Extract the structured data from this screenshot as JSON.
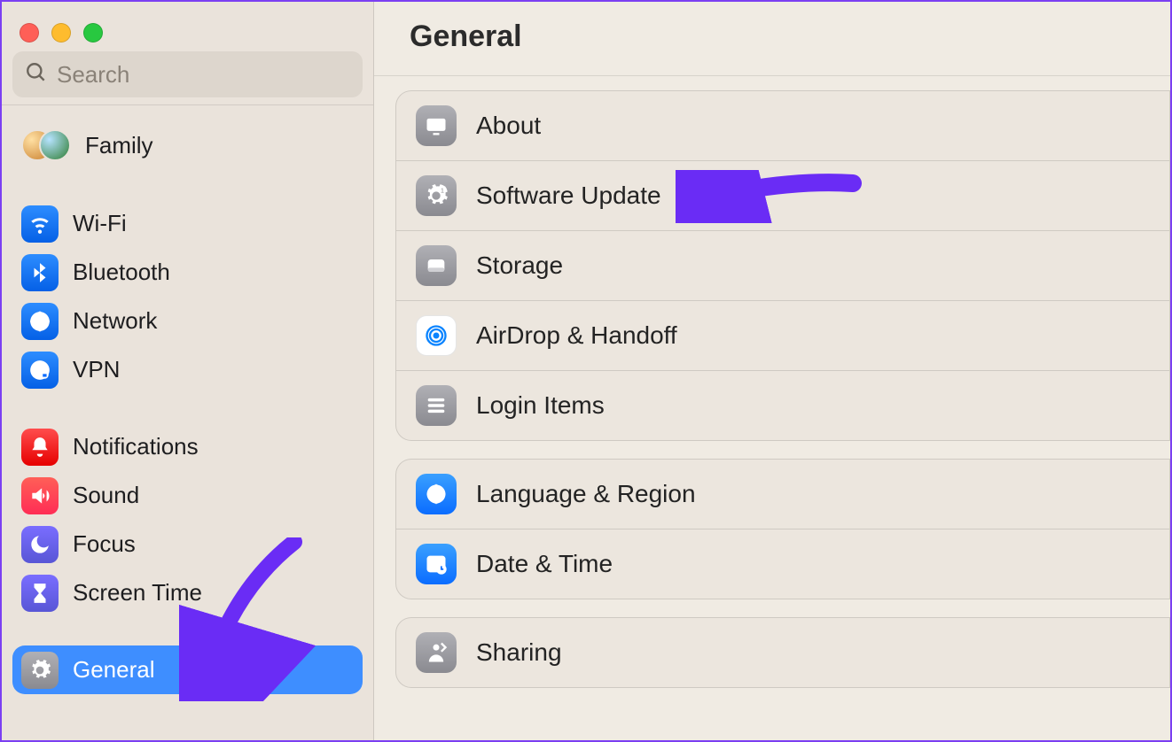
{
  "search": {
    "placeholder": "Search"
  },
  "header": {
    "title": "General"
  },
  "sidebar": {
    "family": {
      "label": "Family"
    },
    "items": [
      {
        "id": "wifi",
        "label": "Wi-Fi"
      },
      {
        "id": "bluetooth",
        "label": "Bluetooth"
      },
      {
        "id": "network",
        "label": "Network"
      },
      {
        "id": "vpn",
        "label": "VPN"
      },
      {
        "id": "notifications",
        "label": "Notifications"
      },
      {
        "id": "sound",
        "label": "Sound"
      },
      {
        "id": "focus",
        "label": "Focus"
      },
      {
        "id": "screentime",
        "label": "Screen Time"
      },
      {
        "id": "general",
        "label": "General",
        "selected": true
      }
    ]
  },
  "main": {
    "groups": [
      {
        "rows": [
          {
            "id": "about",
            "label": "About"
          },
          {
            "id": "swupdate",
            "label": "Software Update"
          },
          {
            "id": "storage",
            "label": "Storage"
          },
          {
            "id": "airdrop",
            "label": "AirDrop & Handoff"
          },
          {
            "id": "loginitems",
            "label": "Login Items"
          }
        ]
      },
      {
        "rows": [
          {
            "id": "langregion",
            "label": "Language & Region"
          },
          {
            "id": "datetime",
            "label": "Date & Time"
          }
        ]
      },
      {
        "rows": [
          {
            "id": "sharing",
            "label": "Sharing"
          }
        ]
      }
    ]
  },
  "annotations": {
    "color": "#6a2cf5"
  }
}
